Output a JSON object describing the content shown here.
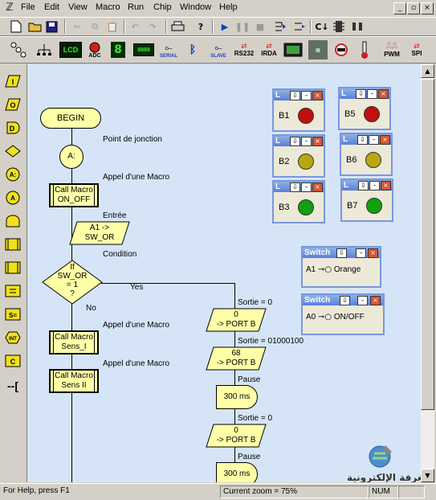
{
  "menu": {
    "items": [
      "File",
      "Edit",
      "View",
      "Macro",
      "Run",
      "Chip",
      "Window",
      "Help"
    ],
    "window_controls": [
      "_",
      "▫",
      "×"
    ]
  },
  "toolbar2": {
    "labels": [
      "LCD",
      "ADC",
      "8888",
      "SERIAL",
      "SLAVE",
      "RS232",
      "IRDA",
      "PWM",
      "SPI"
    ]
  },
  "left_toolbar": {
    "labels": [
      "I",
      "O",
      "D",
      "◇",
      "A:",
      "A",
      "▭",
      "▭",
      "S",
      "=",
      "S=",
      "INT",
      "C",
      "--["
    ]
  },
  "flowchart": {
    "begin": "BEGIN",
    "junction_label": "Point de jonction",
    "junction": "A:",
    "call1_label": "Appel d'une Macro",
    "call1_line1": "Call Macro",
    "call1_line2": "ON_OFF",
    "input_label": "Entrée",
    "input_line1": "A1 ->",
    "input_line2": "SW_OR",
    "cond_label": "Condition",
    "cond_line1": "If",
    "cond_line2": "SW_OR",
    "cond_line3": "= 1",
    "cond_line4": "?",
    "yes": "Yes",
    "no": "No",
    "call2_label": "Appel d'une Macro",
    "call2_line1": "Call Macro",
    "call2_line2": "Sens_I",
    "call3_label": "Appel d'une Macro",
    "call3_line1": "Call Macro",
    "call3_line2": "Sens II",
    "out1_label": "Sortie = 0",
    "out1_line1": "0",
    "out1_line2": "-> PORT B",
    "out2_label": "Sortie = 01000100",
    "out2_line1": "68",
    "out2_line2": "-> PORT B",
    "pause1_label": "Pause",
    "pause1": "300 ms",
    "out3_label": "Sortie = 0",
    "out3_line1": "0",
    "out3_line2": "-> PORT B",
    "pause2_label": "Pause",
    "pause2": "300 ms"
  },
  "leds": [
    {
      "title": "L",
      "label": "B1",
      "color": "#c01010"
    },
    {
      "title": "L",
      "label": "B5",
      "color": "#c01010"
    },
    {
      "title": "L",
      "label": "B2",
      "color": "#b8a810"
    },
    {
      "title": "L",
      "label": "B6",
      "color": "#b8a810"
    },
    {
      "title": "L",
      "label": "B3",
      "color": "#10a010"
    },
    {
      "title": "L",
      "label": "B7",
      "color": "#10a010"
    }
  ],
  "switches": [
    {
      "title": "Switch",
      "port": "A1",
      "name": "Orange"
    },
    {
      "title": "Switch",
      "port": "A0",
      "name": "ON/OFF"
    }
  ],
  "status": {
    "help": "For Help, press F1",
    "zoom": "Current zoom = 75%",
    "num": "NUM"
  },
  "watermark": "الغرفة الإلكترونية"
}
